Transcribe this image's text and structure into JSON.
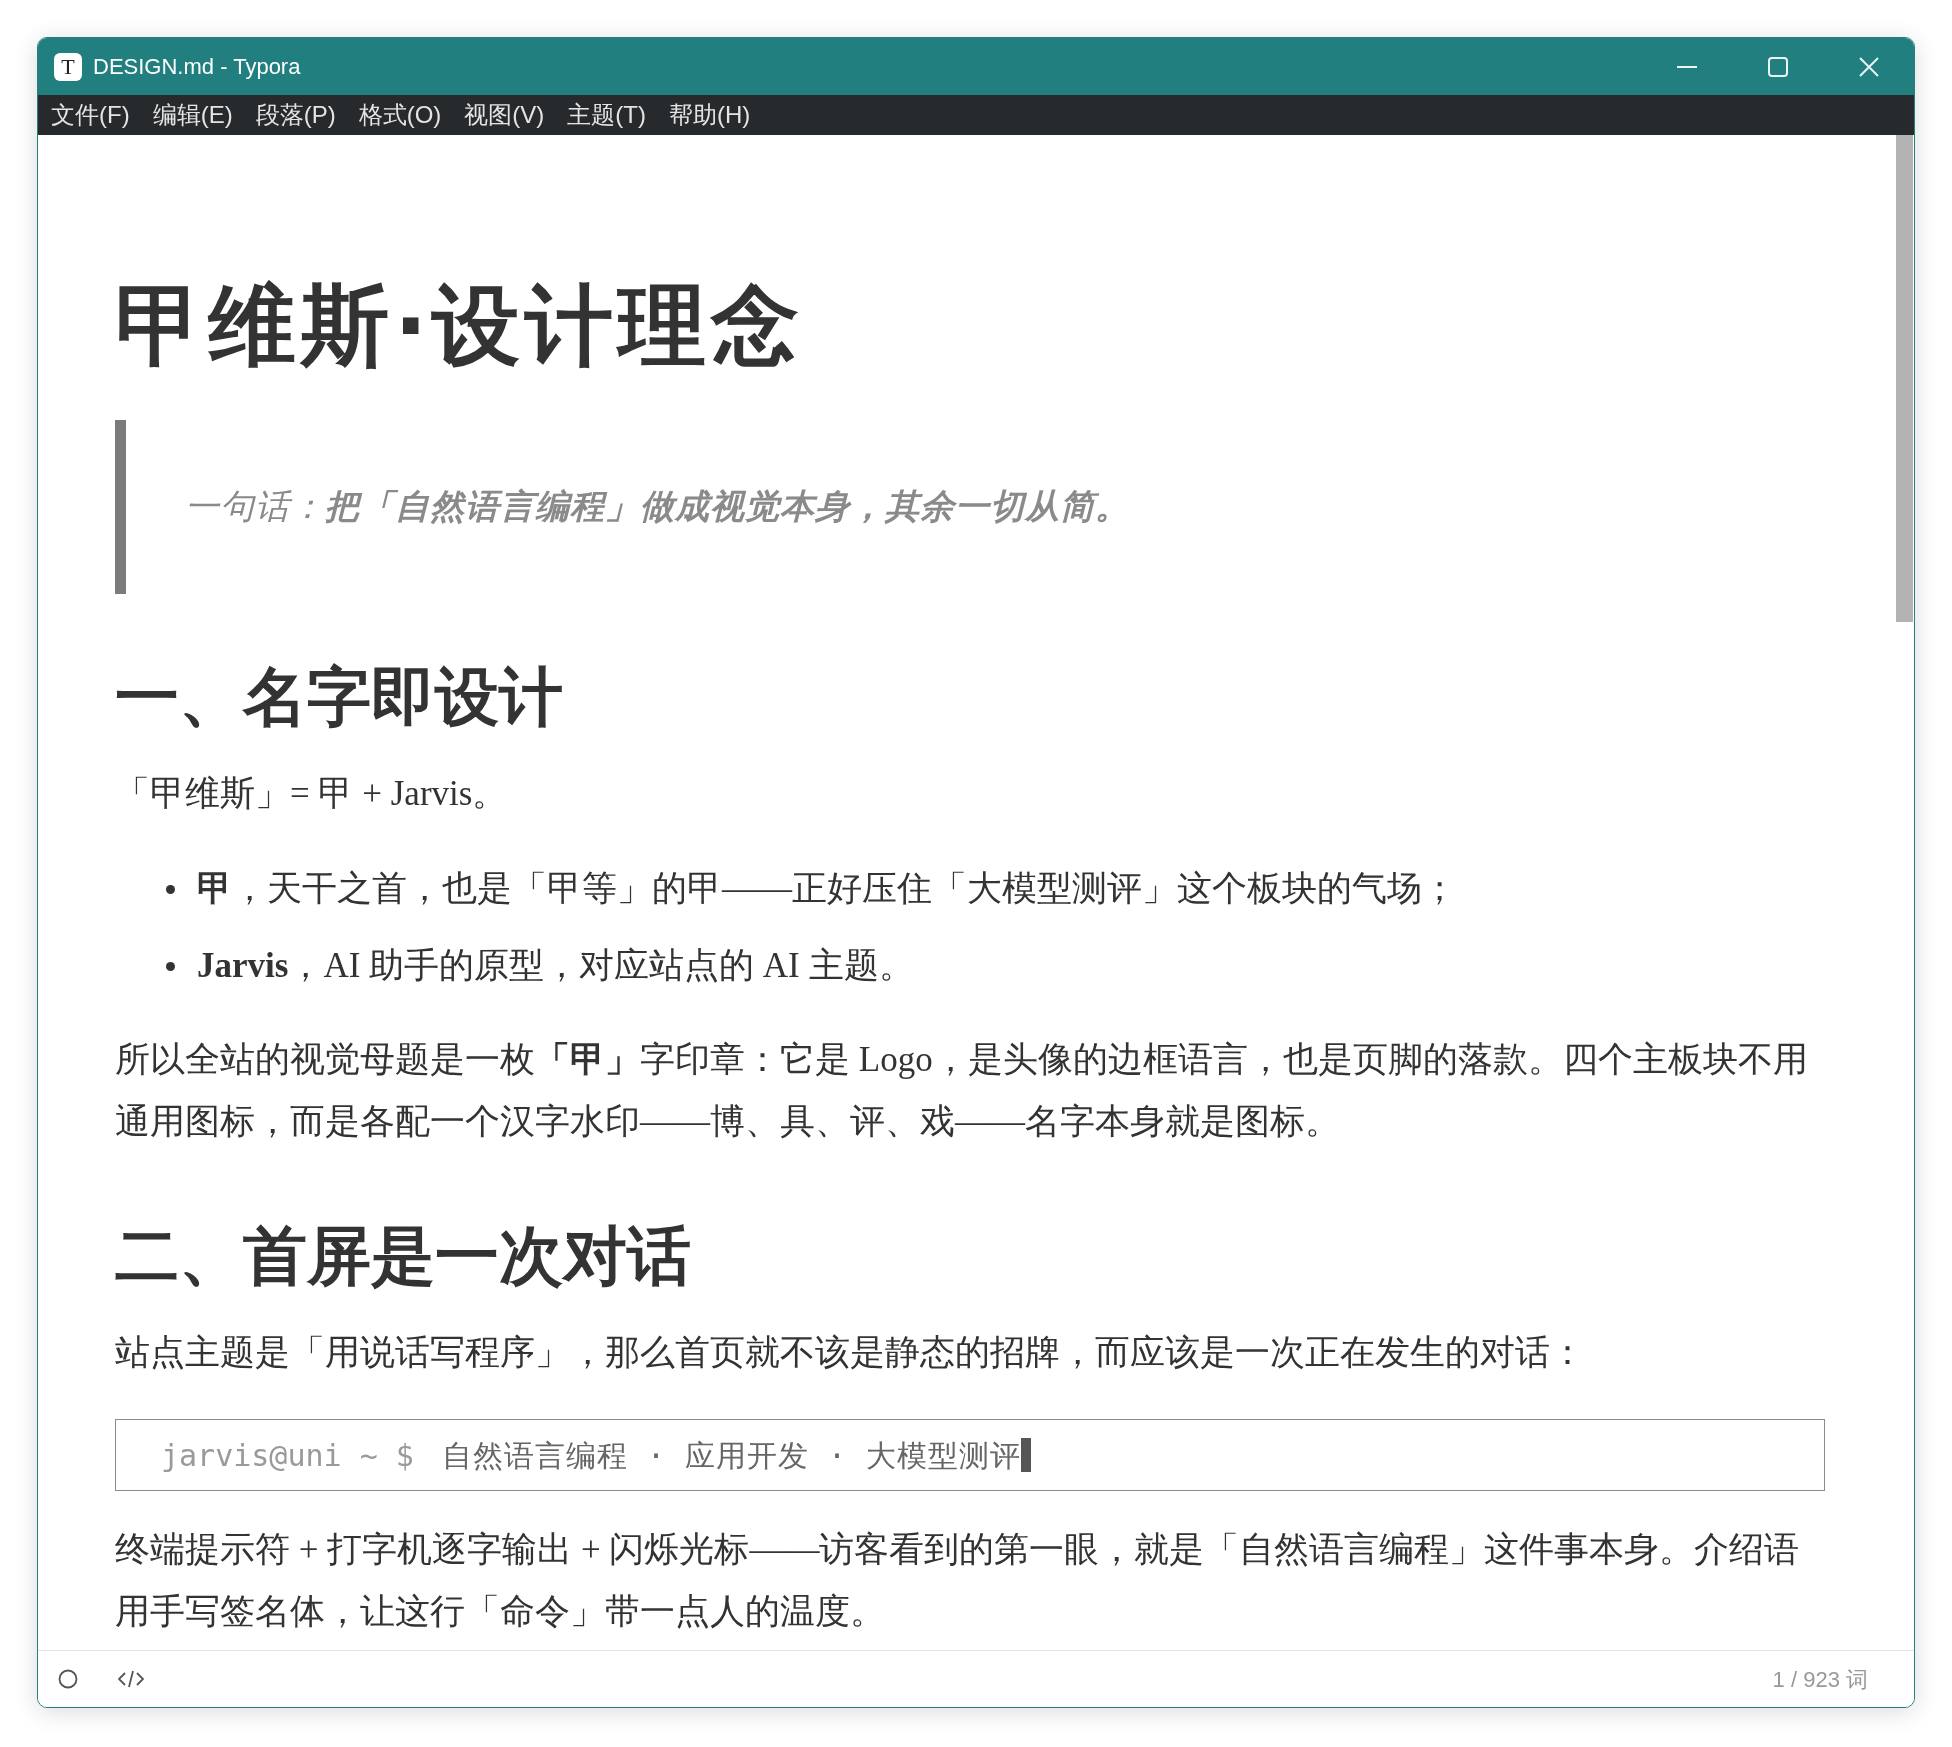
{
  "window": {
    "icon_letter": "T",
    "title": "DESIGN.md - Typora"
  },
  "menu_bar": {
    "items": [
      "文件(F)",
      "编辑(E)",
      "段落(P)",
      "格式(O)",
      "视图(V)",
      "主题(T)",
      "帮助(H)"
    ]
  },
  "document": {
    "blocks": [
      {
        "kind": "h1",
        "text": "甲维斯·设计理念"
      },
      {
        "kind": "blockquote",
        "text": "一句话：**把「自然语言编程」做成视觉本身，其余一切从简。**"
      },
      {
        "kind": "h2",
        "text": "一、名字即设计"
      },
      {
        "kind": "paragraph",
        "text": "「甲维斯」= 甲 + Jarvis。"
      },
      {
        "kind": "list",
        "items": [
          "**甲**，天干之首，也是「甲等」的甲——正好压住「大模型测评」这个板块的气场；",
          "**Jarvis**，AI 助手的原型，对应站点的 AI 主题。"
        ]
      },
      {
        "kind": "paragraph",
        "text": "所以全站的视觉母题是一枚**「甲」**字印章：它是 Logo，是头像的边框语言，也是页脚的落款。四个主板块不用通用图标，而是各配一个汉字水印——博、具、评、戏——名字本身就是图标。"
      },
      {
        "kind": "h2",
        "text": "二、首屏是一次对话"
      },
      {
        "kind": "paragraph",
        "text": "站点主题是「用说话写程序」，那么首页就不该是静态的招牌，而应该是一次正在发生的对话："
      },
      {
        "kind": "code",
        "prompt": "jarvis@uni ~ $",
        "text": "自然语言编程 · 应用开发 · 大模型测评",
        "cursor": true
      },
      {
        "kind": "paragraph",
        "text": "终端提示符 + 打字机逐字输出 + 闪烁光标——访客看到的第一眼，就是「自然语言编程」这件事本身。介绍语用手写签名体，让这行「命令」带一点人的温度。"
      }
    ]
  },
  "status_bar": {
    "word_count": "1 / 923 词"
  }
}
